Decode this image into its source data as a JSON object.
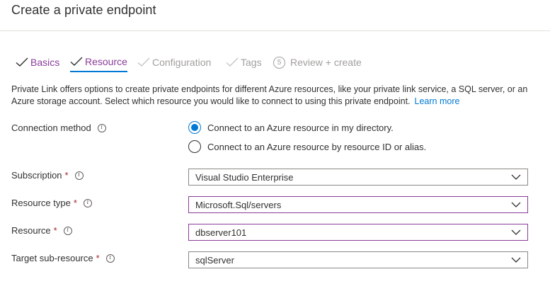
{
  "page": {
    "title": "Create a private endpoint"
  },
  "steps": [
    {
      "label": "Basics",
      "state": "done",
      "icon": "checkmark-icon"
    },
    {
      "label": "Resource",
      "state": "current",
      "icon": "checkmark-icon"
    },
    {
      "label": "Configuration",
      "state": "pending",
      "icon": "checkmark-icon"
    },
    {
      "label": "Tags",
      "state": "pending",
      "icon": "checkmark-icon"
    },
    {
      "label": "Review + create",
      "state": "pending",
      "number": "5"
    }
  ],
  "description": {
    "text": "Private Link offers options to create private endpoints for different Azure resources, like your private link service, a SQL server, or an Azure storage account. Select which resource you would like to connect to using this private endpoint.",
    "link": "Learn more"
  },
  "form": {
    "connection_method": {
      "label": "Connection method",
      "options": [
        {
          "label": "Connect to an Azure resource in my directory.",
          "checked": true
        },
        {
          "label": "Connect to an Azure resource by resource ID or alias.",
          "checked": false
        }
      ]
    },
    "subscription": {
      "label": "Subscription",
      "required": "*",
      "value": "Visual Studio Enterprise"
    },
    "resource_type": {
      "label": "Resource type",
      "required": "*",
      "value": "Microsoft.Sql/servers"
    },
    "resource": {
      "label": "Resource",
      "required": "*",
      "value": "dbserver101"
    },
    "target_sub_resource": {
      "label": "Target sub-resource",
      "required": "*",
      "value": "sqlServer"
    }
  },
  "colors": {
    "accent": "#0078d4",
    "step_done": "#8a3c99",
    "required": "#a4262c",
    "muted": "#a19f9d"
  }
}
